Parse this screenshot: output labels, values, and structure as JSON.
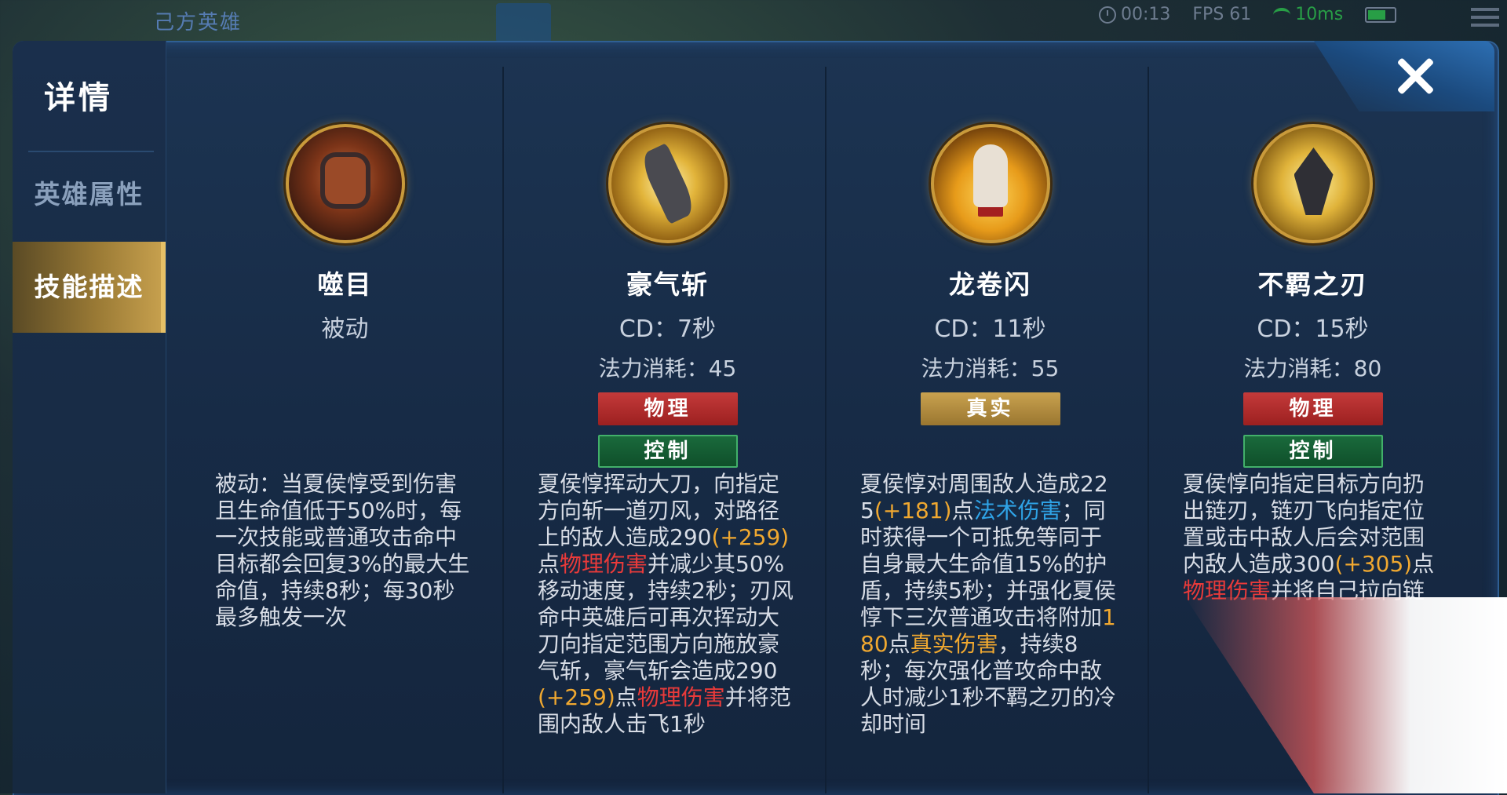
{
  "hud": {
    "team_label": "己方英雄",
    "time": "00:13",
    "fps": "FPS 61",
    "ping": "10ms"
  },
  "panel": {
    "title": "详情",
    "tabs": [
      {
        "label": "英雄属性",
        "active": false
      },
      {
        "label": "技能描述",
        "active": true
      }
    ]
  },
  "skills": [
    {
      "name": "噬目",
      "sub": "被动",
      "icon": "fist-icon",
      "desc": [
        {
          "t": "被动：当夏侯惇受到伤害且生命值低于50%时，每一次技能或普通攻击命中目标都会回复3%的最大生命值，持续8秒；每30秒最多触发一次",
          "c": ""
        }
      ]
    },
    {
      "name": "豪气斩",
      "sub": "CD：7秒",
      "cost": "法力消耗：45",
      "tags": [
        "物理",
        "控制"
      ],
      "icon": "blade-icon",
      "desc": [
        {
          "t": "夏侯惇挥动大刀，向指定方向斩一道刃风，对路径上的敌人造成290",
          "c": ""
        },
        {
          "t": "(+259)",
          "c": "num"
        },
        {
          "t": "点",
          "c": ""
        },
        {
          "t": "物理伤害",
          "c": "phys"
        },
        {
          "t": "并减少其50%移动速度，持续2秒；刃风命中英雄后可再次挥动大刀向指定范围方向施放豪气斩，豪气斩会造成290",
          "c": ""
        },
        {
          "t": "(+259)",
          "c": "num"
        },
        {
          "t": "点",
          "c": ""
        },
        {
          "t": "物理伤害",
          "c": "phys"
        },
        {
          "t": "并将范围内敌人击飞1秒",
          "c": ""
        }
      ]
    },
    {
      "name": "龙卷闪",
      "sub": "CD：11秒",
      "cost": "法力消耗：55",
      "tags": [
        "真实"
      ],
      "icon": "hero-icon",
      "desc": [
        {
          "t": "夏侯惇对周围敌人造成225",
          "c": ""
        },
        {
          "t": "(+181)",
          "c": "num"
        },
        {
          "t": "点",
          "c": ""
        },
        {
          "t": "法术伤害",
          "c": "magic"
        },
        {
          "t": "；同时获得一个可抵免等同于自身最大生命值15%的护盾，持续5秒；并强化夏侯惇下三次普通攻击将附加",
          "c": ""
        },
        {
          "t": "180",
          "c": "num"
        },
        {
          "t": "点",
          "c": ""
        },
        {
          "t": "真实伤害",
          "c": "truedmg"
        },
        {
          "t": "，持续8秒；每次强化普攻命中敌人时减少1秒不羁之刃的冷却时间",
          "c": ""
        }
      ]
    },
    {
      "name": "不羁之刃",
      "sub": "CD：15秒",
      "cost": "法力消耗：80",
      "tags": [
        "物理",
        "控制"
      ],
      "icon": "axe-icon",
      "desc": [
        {
          "t": "夏侯惇向指定目标方向扔出链刃，链刃飞向指定位置或击中敌人后会对范围内敌人造成300",
          "c": ""
        },
        {
          "t": "(+305)",
          "c": "num"
        },
        {
          "t": "点",
          "c": ""
        },
        {
          "t": "物理伤害",
          "c": "phys"
        },
        {
          "t": "并将自己拉向链",
          "c": ""
        }
      ]
    }
  ]
}
